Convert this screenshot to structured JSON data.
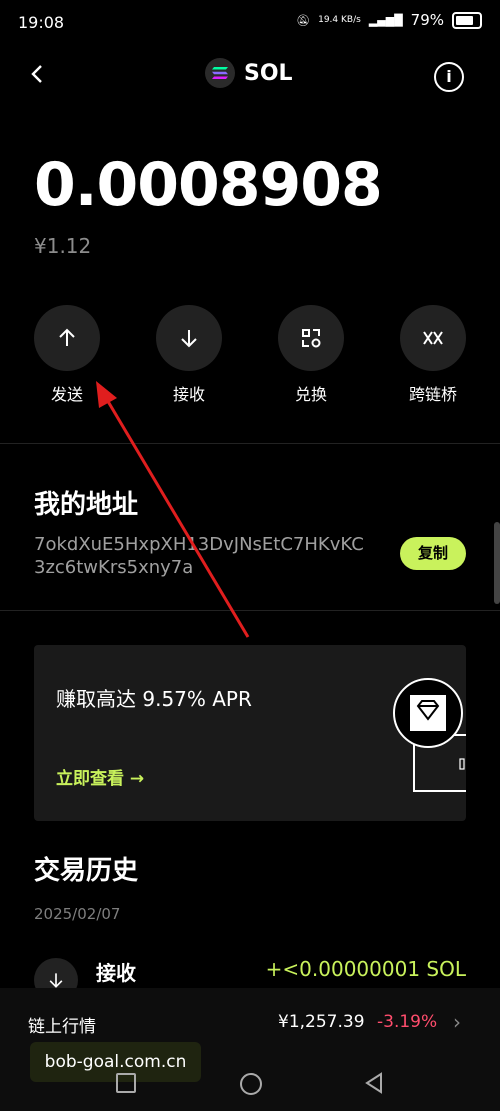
{
  "status": {
    "time": "19:08",
    "net_speed": "19.4 KB/s",
    "battery": "79%"
  },
  "header": {
    "title": "SOL"
  },
  "balance": {
    "amount": "0.0008908",
    "fiat": "¥1.12"
  },
  "actions": [
    {
      "label": "发送",
      "icon": "arrow-up-icon"
    },
    {
      "label": "接收",
      "icon": "arrow-down-icon"
    },
    {
      "label": "兑换",
      "icon": "swap-icon"
    },
    {
      "label": "跨链桥",
      "icon": "bridge-icon"
    }
  ],
  "address": {
    "title": "我的地址",
    "value": "7okdXuE5HxpXH13DvJNsEtC7HKvKC3zc6twKrs5xny7a",
    "copy_label": "复制"
  },
  "promo": {
    "text": "赚取高达 9.57% APR",
    "link": "立即查看 →"
  },
  "history": {
    "title": "交易历史",
    "date": "2025/02/07",
    "items": [
      {
        "label": "接收",
        "amount": "+<0.00000001 SOL"
      }
    ]
  },
  "market": {
    "label": "链上行情",
    "price": "¥1,257.39",
    "change": "-3.19%"
  },
  "watermark": "bob-goal.com.cn",
  "colors": {
    "accent": "#c9f25c",
    "negative": "#ff4d6d",
    "annotation_arrow": "#e01e1e"
  }
}
